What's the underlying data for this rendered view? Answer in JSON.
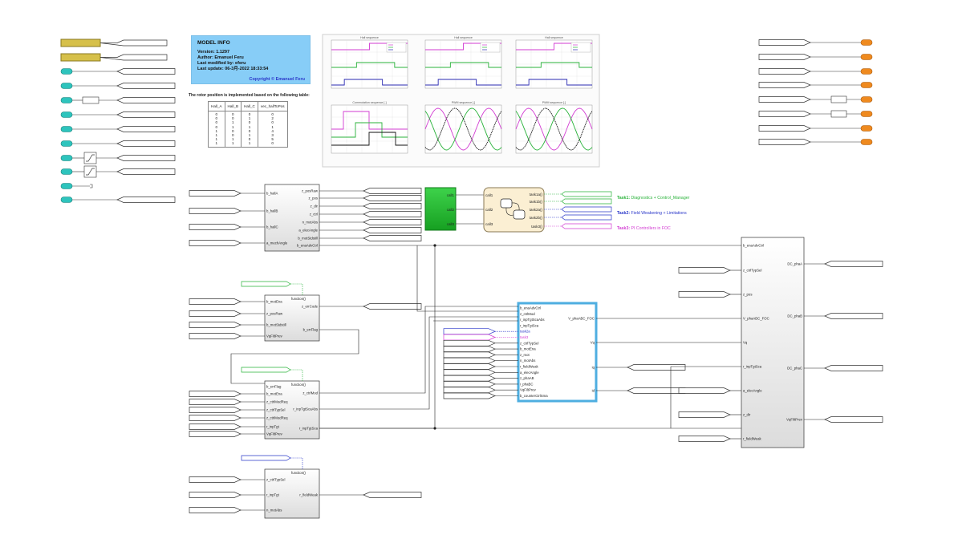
{
  "model_info": {
    "title": "MODEL INFO",
    "version": "Version: 1.1297",
    "author": "Author: Emanuel Feru",
    "modified_by": "Last modified by: eferu",
    "last_update": "Last update: 06-3月-2022 18:33:54",
    "copyright": "Copyright © Emanuel Feru"
  },
  "hall_table": {
    "caption": "The rotor position is implemented based on the following table:",
    "headers": [
      "Hall_A",
      "Hall_B",
      "Hall_C",
      "vec_hallToPos"
    ],
    "rows": [
      [
        "0",
        "0",
        "0",
        "0"
      ],
      [
        "0",
        "0",
        "1",
        "2"
      ],
      [
        "0",
        "1",
        "0",
        "0"
      ],
      [
        "0",
        "1",
        "1",
        "1"
      ],
      [
        "1",
        "0",
        "0",
        "4"
      ],
      [
        "1",
        "0",
        "1",
        "3"
      ],
      [
        "1",
        "1",
        "0",
        "5"
      ],
      [
        "1",
        "1",
        "1",
        "0"
      ]
    ]
  },
  "plots": {
    "titles": [
      "Hall sequence",
      "Hall sequence",
      "Hall sequence",
      "Commutation sequence [-]",
      "PWM sequence [-]",
      "PWM sequence [-]"
    ],
    "colors": {
      "magenta": "#d23bd2",
      "green": "#29b23a",
      "blue": "#2a2ab2",
      "black": "#111111"
    }
  },
  "task_notes": {
    "task1": {
      "key": "Task1:",
      "text": " Diagnostics + Control_Manager"
    },
    "task2": {
      "key": "Task2:",
      "text": " Field Weakening + Limitations"
    },
    "task3": {
      "key": "Task3:",
      "text": " PI Controllers in FOC"
    }
  },
  "stateflow": {
    "ports_in": [
      "call1",
      "call2",
      "call3"
    ],
    "ports_out": [
      "task1a()",
      "task1b()",
      "task2a()",
      "task2b()",
      "task3()"
    ]
  },
  "scheduler_ports": [
    "call1",
    "call2",
    "call3"
  ],
  "blocks": {
    "hall": {
      "in": [
        "b_hallA",
        "b_hallB",
        "b_hallC",
        "a_mechAngle"
      ],
      "out": [
        "z_posRaw",
        "z_pos",
        "z_dir",
        "z_ctrl",
        "n_motAbs",
        "a_elecAngle",
        "b_motStdstill",
        "b_enaAdvCtrl"
      ]
    },
    "diag": {
      "title": "function()",
      "in": [
        "b_motEna",
        "z_posRaw",
        "b_motStdstill",
        "VqFiltPrev"
      ],
      "out": [
        "z_errCode",
        "b_errFlag"
      ]
    },
    "ctrl": {
      "title": "function()",
      "in": [
        "b_errFlag",
        "b_motEna",
        "z_ctrlModReq",
        "z_ctrlTypSel",
        "z_ctrlModReq",
        "r_inpTgt",
        "VqFiltPrev"
      ],
      "out": [
        "z_ctrlMod",
        "r_inpTgtScaAbs",
        "r_inpTgtSca"
      ]
    },
    "fw": {
      "title": "function()",
      "in": [
        "z_ctrlTypSel",
        "r_inpTgt",
        "n_motAbs"
      ],
      "out": [
        "r_fieldWeak"
      ]
    },
    "foc": {
      "in": [
        "b_enaAdvCtrl",
        "z_ctrlMod",
        "r_inpTgtScaAbs",
        "r_inpTgtSca",
        "task2a",
        "task3",
        "z_ctrlTypSel",
        "b_motEna",
        "z_mot",
        "n_motAbs",
        "r_fieldWeak",
        "a_elecAngle",
        "z_phaAB",
        "i_phaBC",
        "VqFiltPrev",
        "b_counterCtrlSma"
      ],
      "out": [
        "V_phaABC_FOC",
        "Vq",
        "iq",
        "id"
      ]
    },
    "pwm": {
      "in": [
        "b_enaAdvCtrl",
        "z_ctrlTypSel",
        "z_pos",
        "V_phaABC_FOC",
        "Vq",
        "r_inpTgtSca",
        "a_elecAngle",
        "z_dir",
        "r_fieldWeak"
      ],
      "out": [
        "DC_phaA",
        "DC_phaB",
        "DC_phaC",
        "VqFiltPrev"
      ]
    }
  },
  "colors": {
    "inport": "#2ec4bd",
    "outport": "#ef8a1f",
    "constant": "#d6c04a",
    "stateflow": "#fbefd3",
    "scheduler": "#2bbf3a",
    "foc_border": "#4eaee0",
    "task1": "#29b23a",
    "task2": "#2a37c9",
    "task3": "#d23bd2"
  }
}
